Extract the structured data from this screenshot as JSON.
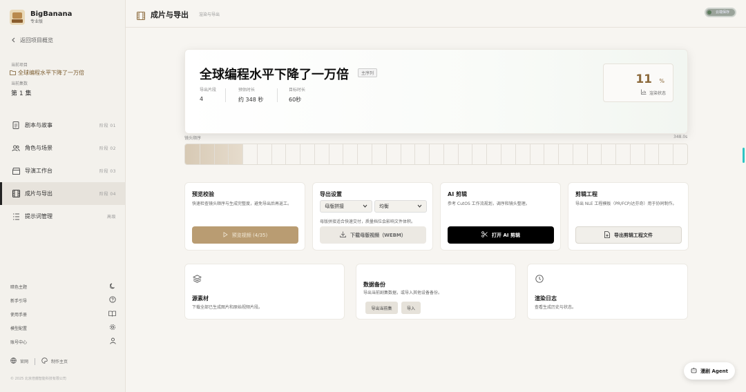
{
  "app": {
    "name": "BigBanana",
    "edition": "专业版"
  },
  "sidebar": {
    "back_label": "返回项目概览",
    "current_project_label": "当前项目",
    "current_project_name": "全球编程水平下降了一万倍",
    "current_episode_label": "当前集数",
    "current_episode_value": "第 1 集",
    "items": [
      {
        "label": "剧本与故事",
        "tag": "阶段 01",
        "icon": "document-icon"
      },
      {
        "label": "角色与场景",
        "tag": "阶段 02",
        "icon": "users-icon"
      },
      {
        "label": "导演工作台",
        "tag": "阶段 03",
        "icon": "clapperboard-icon"
      },
      {
        "label": "成片与导出",
        "tag": "阶段 04",
        "icon": "film-icon"
      },
      {
        "label": "提示词管理",
        "tag": "高级",
        "icon": "list-icon"
      }
    ],
    "bottom": [
      {
        "label": "暗色主题",
        "icon": "moon-icon"
      },
      {
        "label": "新手引导",
        "icon": "help-icon"
      },
      {
        "label": "使用手册",
        "icon": "book-icon"
      },
      {
        "label": "模型配置",
        "icon": "gear-icon"
      },
      {
        "label": "账号中心",
        "icon": "user-icon"
      }
    ],
    "footer": {
      "official": "官网",
      "studio": "制作主页",
      "copyright": "© 2025 北京倍蕴智能科技有限公司"
    }
  },
  "header": {
    "title": "成片与导出",
    "subtitle": "渲染与导出",
    "toggle_label": "云端保存"
  },
  "hero": {
    "title": "全球编程水平下降了一万倍",
    "badge": "主序列",
    "stats": [
      {
        "label": "导出片段",
        "value": "4"
      },
      {
        "label": "预估时长",
        "value": "约 348 秒"
      },
      {
        "label": "目标时长",
        "value": "60秒"
      }
    ],
    "progress_value": "11",
    "progress_unit": "%",
    "progress_label": "渲染状态",
    "progress_fraction": 0.11
  },
  "timeline": {
    "label": "镜头顺序",
    "duration": "348.0s",
    "filled_fraction": 0.115,
    "segments": 35
  },
  "cards": {
    "preview": {
      "title": "预览校验",
      "desc": "快速检查镜头顺序与生成完整度，避免导出后再返工。",
      "button": "预览视频 (4/35)"
    },
    "export": {
      "title": "导出设置",
      "select_mode": "母版拼接",
      "select_quality": "均衡",
      "note": "母版拼接适合快速交付，质量档位会影响文件体积。",
      "button": "下载母版视频（WEBM）"
    },
    "ai": {
      "title": "AI 剪辑",
      "desc": "参考 CutOS 工作流规划，调序和镜头整理。",
      "button": "打开 AI 剪辑"
    },
    "project": {
      "title": "剪辑工程",
      "desc": "导出 NLE 工程模板（PR/FCP/达芬奇）用于协同制作。",
      "button": "导出剪辑工程文件"
    },
    "assets": {
      "title": "源素材",
      "desc": "下载全部已生成图片和原始视频片段。"
    },
    "backup": {
      "title": "数据备份",
      "desc": "导出当前剧集数据，或导入其他设备备份。",
      "btn_export": "导出当前集",
      "btn_import": "导入"
    },
    "log": {
      "title": "渲染日志",
      "desc": "查看生成历史与状态。"
    }
  },
  "agent": {
    "label": "漫剧 Agent"
  }
}
